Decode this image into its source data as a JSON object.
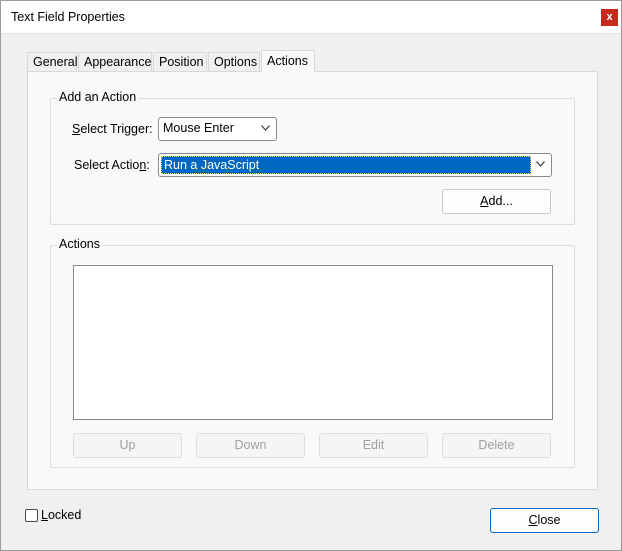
{
  "window": {
    "title": "Text Field Properties",
    "close_glyph": "x"
  },
  "tabs": [
    {
      "label": "General"
    },
    {
      "label": "Appearance"
    },
    {
      "label": "Position"
    },
    {
      "label": "Options"
    },
    {
      "label": "Actions",
      "active": true
    }
  ],
  "add_action": {
    "group_label": "Add an Action",
    "trigger_label_u": "S",
    "trigger_label_rest": "elect Trigger:",
    "trigger_value": "Mouse Enter",
    "action_label_pre": "Select Actio",
    "action_label_u": "n",
    "action_label_post": ":",
    "action_value": "Run a JavaScript",
    "add_button_u": "A",
    "add_button_rest": "dd..."
  },
  "actions": {
    "group_label": "Actions",
    "items": [],
    "buttons": {
      "up": "Up",
      "down": "Down",
      "edit": "Edit",
      "delete": "Delete"
    }
  },
  "footer": {
    "locked_u": "L",
    "locked_rest": "ocked",
    "close_u": "C",
    "close_rest": "lose"
  },
  "colors": {
    "selection": "#0067c0",
    "close_button": "#c42b1c",
    "primary_border": "#0067c0"
  },
  "icons": {
    "dropdown": "chevron-down-icon",
    "close": "close-icon"
  }
}
